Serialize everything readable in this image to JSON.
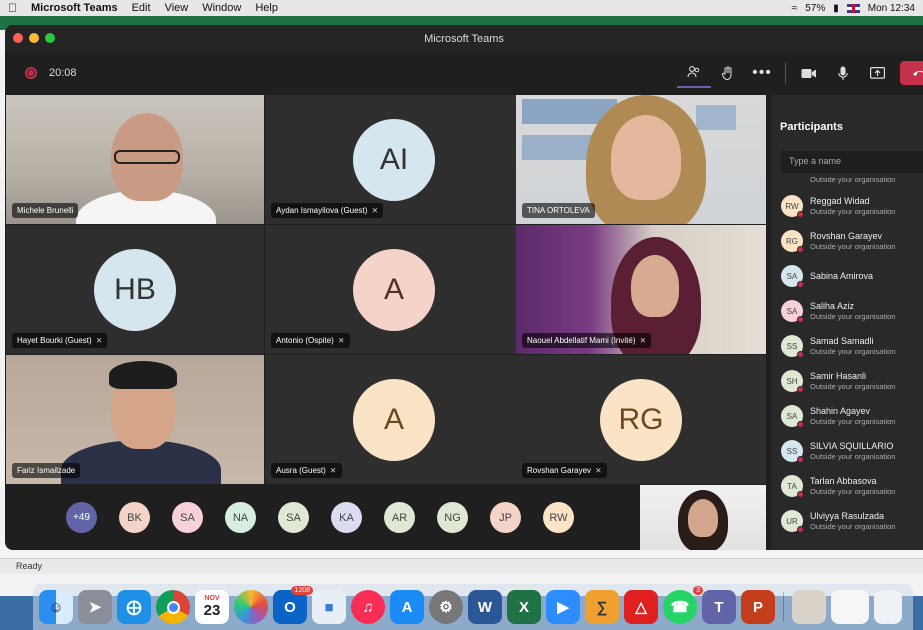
{
  "menubar": {
    "app": "Microsoft Teams",
    "items": [
      "Edit",
      "View",
      "Window",
      "Help"
    ],
    "battery": "57%",
    "clock": "Mon 12:34"
  },
  "excel": {
    "status": "Ready"
  },
  "window": {
    "title": "Microsoft Teams"
  },
  "call": {
    "timer": "20:08",
    "colors": {
      "leave": "#c4314b",
      "accent": "#6264a7"
    }
  },
  "tiles": [
    {
      "name": "Michele Brunelli",
      "type": "video",
      "muted": false
    },
    {
      "name": "Aydan Ismayilova (Guest)",
      "type": "avatar",
      "initials": "AI",
      "color": "#d6e6ee",
      "muted": true
    },
    {
      "name": "TINA ORTOLEVA",
      "type": "video",
      "muted": false
    },
    {
      "name": "Hayet Bourki (Guest)",
      "type": "avatar",
      "initials": "HB",
      "color": "#d6e6ee",
      "muted": true
    },
    {
      "name": "Antonio (Ospite)",
      "type": "avatar",
      "initials": "A",
      "color": "#f4d3c8",
      "muted": true
    },
    {
      "name": "Naouel Abdellatif Mami (Invité)",
      "type": "video",
      "muted": true
    },
    {
      "name": "Fariz Ismailzade",
      "type": "video",
      "muted": false
    },
    {
      "name": "Ausra (Guest)",
      "type": "avatar",
      "initials": "A",
      "color": "#fbe3c6",
      "muted": true
    },
    {
      "name": "Rovshan Garayev",
      "type": "avatar",
      "initials": "RG",
      "color": "#fbe3c6",
      "muted": true
    }
  ],
  "strip": [
    {
      "initials": "+49",
      "color": "#6264a7"
    },
    {
      "initials": "BK",
      "color": "#f4d3c8"
    },
    {
      "initials": "SA",
      "color": "#f7d0d8"
    },
    {
      "initials": "NA",
      "color": "#d6eee0"
    },
    {
      "initials": "SA",
      "color": "#dfe8d4"
    },
    {
      "initials": "KA",
      "color": "#dcdcf0"
    },
    {
      "initials": "AR",
      "color": "#dfe8d4"
    },
    {
      "initials": "NG",
      "color": "#dfe8d4"
    },
    {
      "initials": "JP",
      "color": "#f4d3c8"
    },
    {
      "initials": "RW",
      "color": "#fbe3c6"
    }
  ],
  "panel": {
    "title": "Participants",
    "search_placeholder": "Type a name",
    "top_sub": "Outside your organisation",
    "participants": [
      {
        "initials": "RW",
        "name": "Reggad Widad",
        "sub": "Outside your organisation",
        "color": "#fbe3c6",
        "status": "#c4314b"
      },
      {
        "initials": "RG",
        "name": "Rovshan Garayev",
        "sub": "Outside your organisation",
        "color": "#fbe3c6",
        "status": "#c4314b"
      },
      {
        "initials": "SA",
        "name": "Sabina Amirova",
        "sub": "",
        "color": "#d6e6ee",
        "status": "#c4314b"
      },
      {
        "initials": "SA",
        "name": "Saliha Aziz",
        "sub": "Outside your organisation",
        "color": "#f7d0d8",
        "status": "#c4314b"
      },
      {
        "initials": "SS",
        "name": "Samad Samadli",
        "sub": "Outside your organisation",
        "color": "#dfe8d4",
        "status": "#c4314b"
      },
      {
        "initials": "SH",
        "name": "Samir Hasanli",
        "sub": "Outside your organisation",
        "color": "#dfe8d4",
        "status": "#c4314b"
      },
      {
        "initials": "SA",
        "name": "Shahin Agayev",
        "sub": "Outside your organisation",
        "color": "#dfe8d4",
        "status": "#c4314b"
      },
      {
        "initials": "SS",
        "name": "SILVIA SQUILLARIO",
        "sub": "Outside your organisation",
        "color": "#d6e6ee",
        "status": "#c4314b"
      },
      {
        "initials": "TA",
        "name": "Tarlan Abbasova",
        "sub": "Outside your organisation",
        "color": "#dfe8d4",
        "status": "#c4314b"
      },
      {
        "initials": "UR",
        "name": "Ulviyya Rasulzada",
        "sub": "Outside your organisation",
        "color": "#dfe8d4",
        "status": "#c4314b"
      }
    ]
  },
  "dock": {
    "calendar": {
      "month": "NOV",
      "day": "23"
    },
    "outlook_badge": "1208",
    "whatsapp_badge": "3"
  }
}
